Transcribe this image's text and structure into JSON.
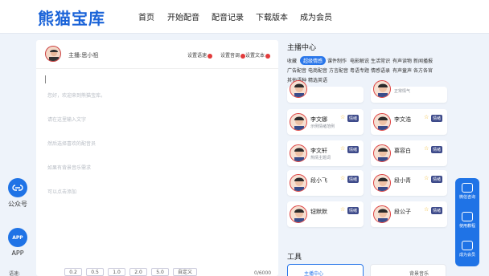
{
  "header": {
    "logo": "熊猫宝库",
    "nav": [
      "首页",
      "开始配音",
      "配音记录",
      "下载版本",
      "成为会员"
    ]
  },
  "left_float": {
    "items": [
      {
        "label": "公众号",
        "icon": "link-icon"
      },
      {
        "label": "APP",
        "icon": "app-icon",
        "icon_text": "APP"
      }
    ]
  },
  "editor": {
    "anchor_label": "主播:思小祖",
    "settings": [
      "设置语速",
      "设置音调",
      "设置文本"
    ],
    "placeholder_lines": [
      "您好，欢迎来到熊猫宝库。",
      "请在这里输入文字",
      "然后选择喜欢的配音员",
      "如果有背景音乐需求",
      "可以点击添加"
    ],
    "speed_label": "语速:",
    "speeds": [
      "0.2",
      "0.5",
      "1.0",
      "2.0",
      "5.0",
      "自定义"
    ],
    "char_count": "0/6000"
  },
  "anchors": {
    "title": "主播中心",
    "tags_row1": [
      "收藏",
      "超级情感",
      "课件制作",
      "电影解说",
      "生活常识",
      "有声读物",
      "新闻播报"
    ],
    "tags_row2": [
      "广告配音",
      "电商配音",
      "方言配音",
      "粤语专题",
      "情感语录",
      "有声童声",
      "各方各官"
    ],
    "tags_row3": [
      "其他语种",
      "精选英语"
    ],
    "active_tag": "超级情感",
    "cards": [
      {
        "name": "",
        "sub": "",
        "col": 0
      },
      {
        "name": "",
        "sub": "正常情气",
        "col": 1
      },
      {
        "name": "李文娜",
        "sub": "示例情绪范例",
        "col": 0
      },
      {
        "name": "李文浩",
        "sub": "",
        "col": 1
      },
      {
        "name": "李文轩",
        "sub": "热情主题词",
        "col": 0
      },
      {
        "name": "慕容白",
        "sub": "",
        "col": 1
      },
      {
        "name": "段小飞",
        "sub": "",
        "col": 0
      },
      {
        "name": "段小青",
        "sub": "",
        "col": 1
      },
      {
        "name": "钮默默",
        "sub": "",
        "col": 0
      },
      {
        "name": "段公子",
        "sub": "",
        "col": 1
      }
    ],
    "badge": "情绪"
  },
  "tools": {
    "title": "工具",
    "items": [
      "主播中心",
      "背景音乐"
    ]
  },
  "right_float": {
    "items": [
      "微信咨询",
      "使用教程",
      "成为会员"
    ]
  },
  "colors": {
    "primary": "#1f73e6",
    "logo": "#1a63d8",
    "background": "#eef3fa"
  }
}
